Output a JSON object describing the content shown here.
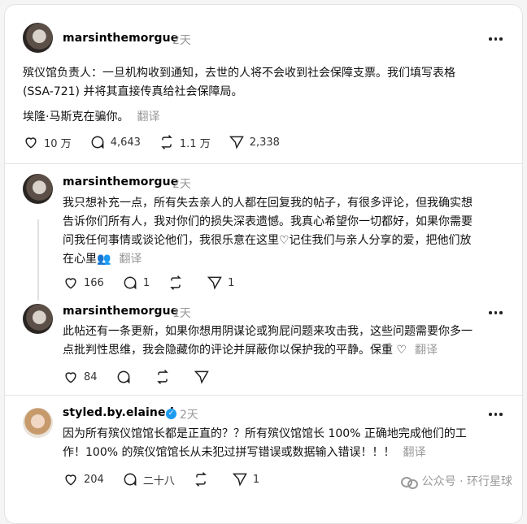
{
  "posts": [
    {
      "username": "marsinthemorgue",
      "time": "2天",
      "line1": "殡仪馆负责人：一旦机构收到通知，去世的人将不会收到社会保障支票。我们填写表格",
      "line2": "(SSA-721) 并将其直接传真给社会保障局。",
      "line3": "埃隆·马斯克在骗你。",
      "translate": "翻译",
      "likes": "10 万",
      "replies": "4,643",
      "reposts": "1.1 万",
      "shares": "2,338"
    },
    {
      "username": "marsinthemorgue",
      "time": "2天",
      "line1": "我只想补充一点，所有失去亲人的人都在回复我的帖子，有很多评论，但我确实想",
      "line2": "告诉你们所有人，我对你们的损失深表遗憾。我真心希望你一切都好，如果你需要",
      "line3": "问我任何事情或谈论他们，我很乐意在这里♡记住我们与亲人分享的爱，把他们放",
      "line4": "在心里👥",
      "translate": "翻译",
      "likes": "166",
      "replies": "1",
      "reposts": "",
      "shares": "1"
    },
    {
      "username": "marsinthemorgue",
      "time": "1天",
      "line1": "此帖还有一条更新，如果你想用阴谋论或狗屁问题来攻击我，这些问题需要你多一",
      "line2": "点批判性思维，我会隐藏你的评论并屏蔽你以保护我的平静。保重 ♡",
      "translate": "翻译",
      "likes": "84",
      "replies": "",
      "reposts": "",
      "shares": ""
    },
    {
      "username": "styled.by.elaine.j",
      "time": "2天",
      "line1": "因为所有殡仪馆馆长都是正直的？？所有殡仪馆馆长 100% 正确地完成他们的工",
      "line2": "作！100% 的殡仪馆馆长从未犯过拼写错误或数据输入错误！！！",
      "translate": "翻译",
      "likes": "204",
      "replies": "二十八",
      "reposts": "",
      "shares": "1"
    }
  ],
  "watermark": "公众号 · 环行星球"
}
